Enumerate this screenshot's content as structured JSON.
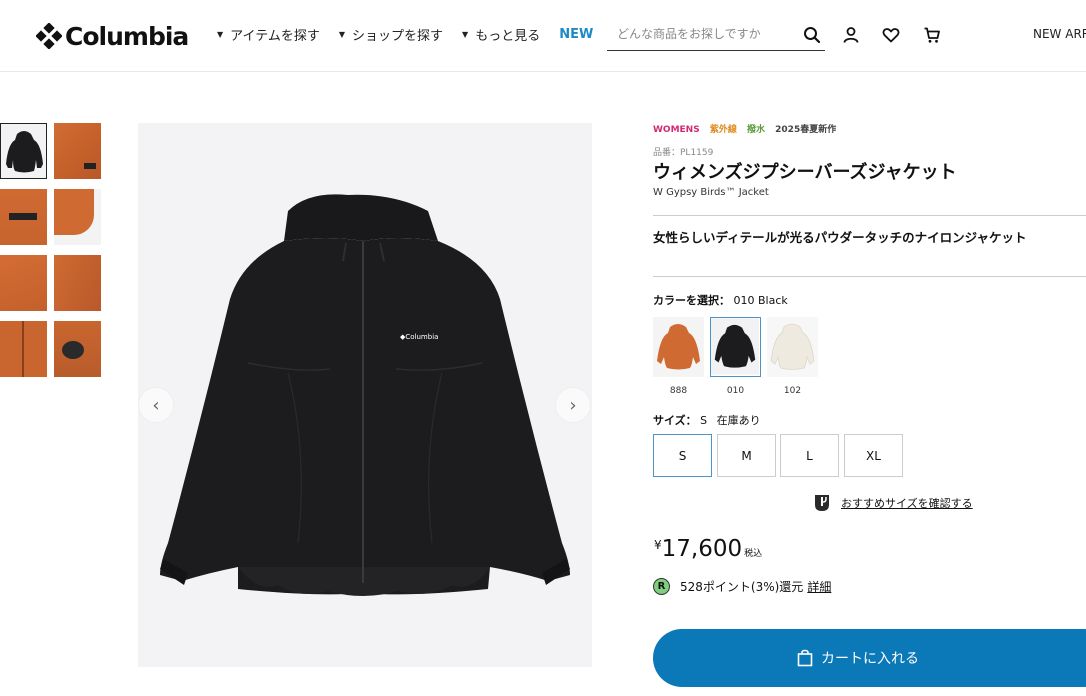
{
  "header": {
    "logo_text": "Columbia",
    "nav": [
      {
        "label": "アイテムを探す"
      },
      {
        "label": "ショップを探す"
      },
      {
        "label": "もっと見る"
      }
    ],
    "nav_new": "NEW",
    "search_placeholder": "どんな商品をお探しですか",
    "right_link": "NEW ARR"
  },
  "gallery": {
    "thumbnails": [
      {
        "color": "#1c1c1e"
      },
      {
        "color": "#c9662f"
      },
      {
        "color": "#c9662f"
      },
      {
        "color": "#cf6a32"
      },
      {
        "color": "#c9662f"
      },
      {
        "color": "#c86530"
      },
      {
        "color": "#c9662f"
      },
      {
        "color": "#b85c2c"
      }
    ],
    "prev_arrow": "‹",
    "next_arrow": "›",
    "jacket_logo": "◆Columbia"
  },
  "product": {
    "tags": [
      {
        "label": "WOMENS",
        "color": "#d12b73"
      },
      {
        "label": "紫外線",
        "color": "#e08a1e"
      },
      {
        "label": "撥水",
        "color": "#5a9b3a"
      },
      {
        "label": "2025春夏新作",
        "color": "#444444"
      }
    ],
    "sku": "品番：PL1159",
    "title": "ウィメンズジプシーバーズジャケット",
    "subtitle": "W Gypsy Birds™ Jacket",
    "tagline": "女性らしいディテールが光るパウダータッチのナイロンジャケット",
    "color_label": "カラーを選択：",
    "color_value": "010 Black",
    "colors": [
      {
        "code": "888",
        "color": "#cf6a32"
      },
      {
        "code": "010",
        "color": "#1c1c1e"
      },
      {
        "code": "102",
        "color": "#f1ede4"
      }
    ],
    "size_label": "サイズ：",
    "size_value": "S",
    "stock": "在庫あり",
    "sizes": [
      "S",
      "M",
      "L",
      "XL"
    ],
    "size_guide": "おすすめサイズを確認する",
    "price_yen": "¥",
    "price": "17,600",
    "tax": "税込",
    "points_badge": "R",
    "points_text": "528ポイント(3%)還元",
    "points_link": "詳細",
    "cart_button": "カートに入れる"
  },
  "colors": {
    "accent": "#0b78b7",
    "selected_border": "#4b93c9",
    "new_link": "#1d8ac7"
  }
}
